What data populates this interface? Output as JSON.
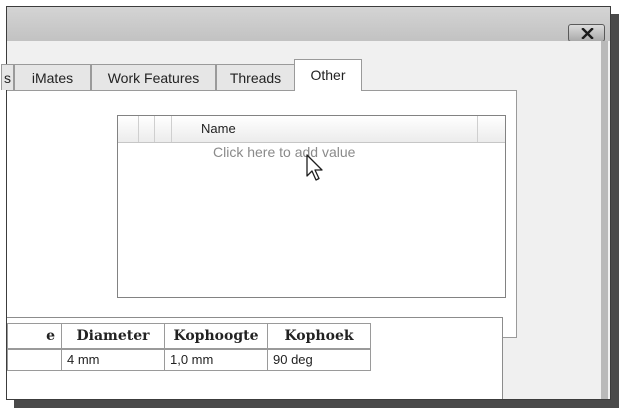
{
  "window": {
    "close_icon": "close-x-icon"
  },
  "tabs": [
    {
      "label": "s",
      "active": false
    },
    {
      "label": "iMates",
      "active": false
    },
    {
      "label": "Work Features",
      "active": false
    },
    {
      "label": "Threads",
      "active": false
    },
    {
      "label": "Other",
      "active": true
    }
  ],
  "property_grid": {
    "column_name": "Name",
    "add_value_prompt": "Click here to add value"
  },
  "thread_table": {
    "headers": [
      "e",
      "Diameter",
      "Kophoogte",
      "Kophoek"
    ],
    "rows": [
      [
        "",
        "4 mm",
        "1,0 mm",
        "90 deg"
      ]
    ]
  }
}
